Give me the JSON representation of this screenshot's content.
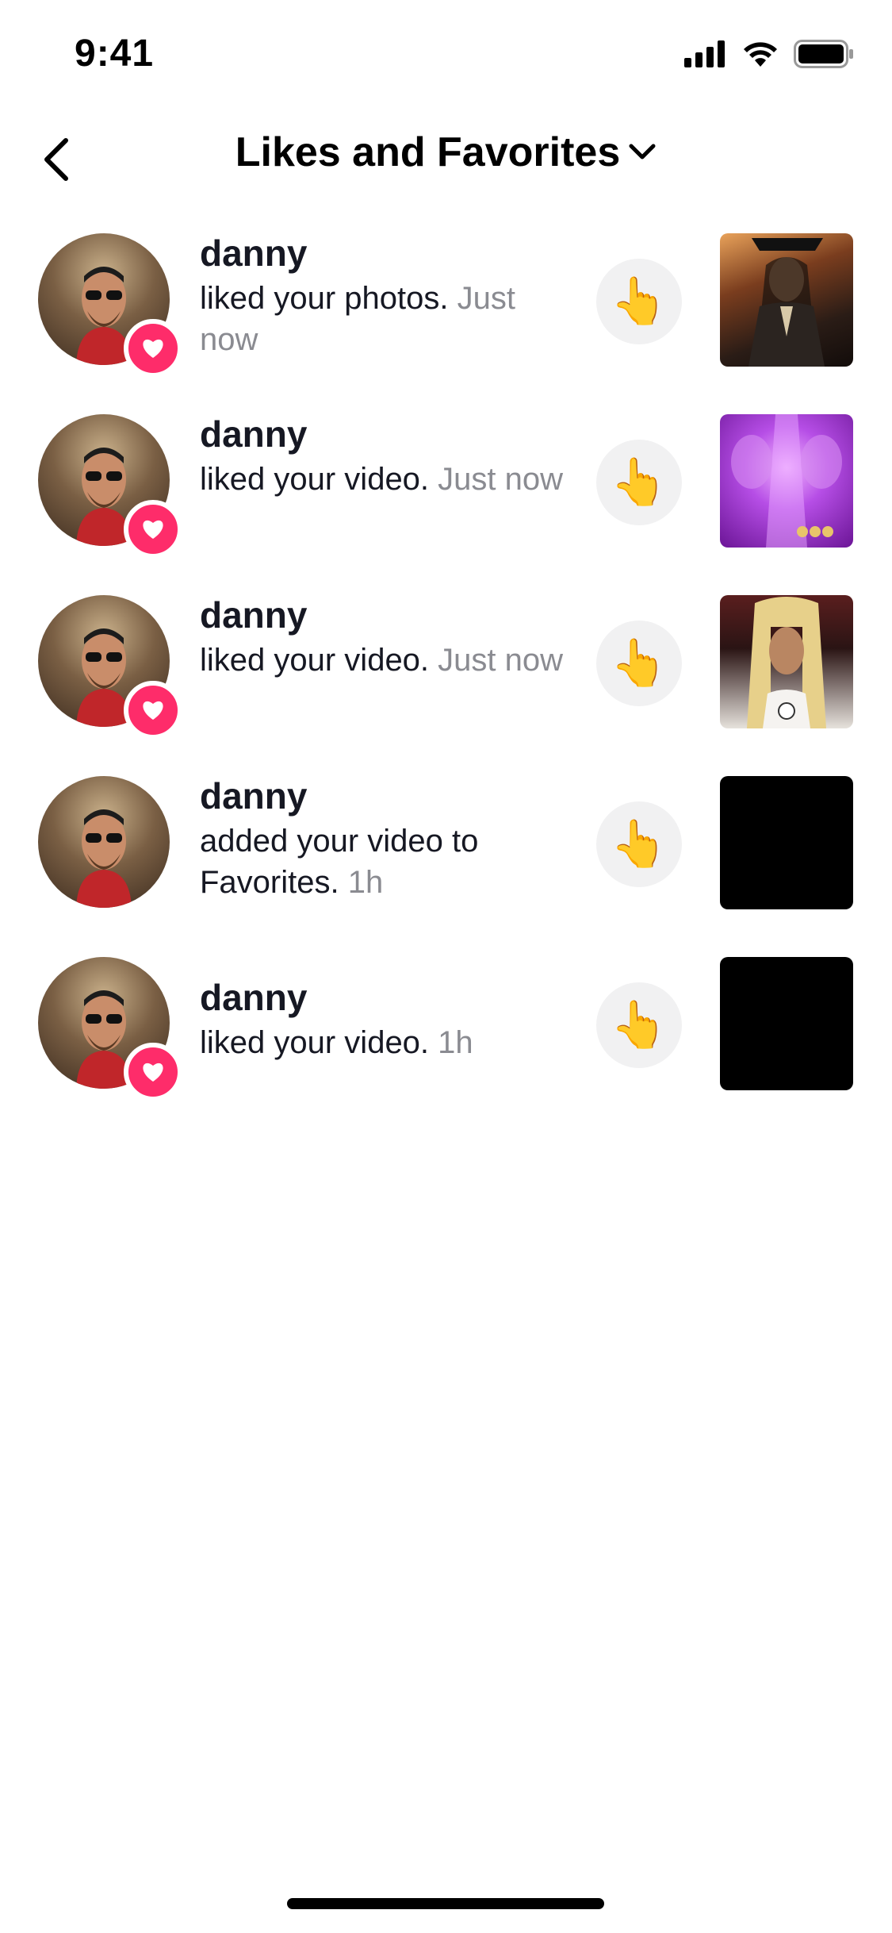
{
  "status_bar": {
    "time": "9:41"
  },
  "header": {
    "title": "Likes and Favorites"
  },
  "colors": {
    "accent_pink": "#fe2c6a",
    "secondary_text": "#8a8b91"
  },
  "notifications": [
    {
      "username": "danny",
      "action": "liked your photos.",
      "time": "Just now",
      "thumbnail": "pirate-portrait"
    },
    {
      "username": "danny",
      "action": "liked your video.",
      "time": "Just now",
      "thumbnail": "purple-effect"
    },
    {
      "username": "danny",
      "action": "liked your video.",
      "time": "Just now",
      "thumbnail": "blonde-portrait"
    },
    {
      "username": "danny",
      "action": "added your video to Favorites.",
      "time": "1h",
      "thumbnail": "black"
    },
    {
      "username": "danny",
      "action": "liked your video.",
      "time": "1h",
      "thumbnail": "black"
    }
  ],
  "icons": {
    "back": "chevron-left-icon",
    "title_dropdown": "chevron-down-icon",
    "badge": "heart-icon",
    "like_back": "pointing-hand-emoji"
  },
  "like_back_glyph": "👆"
}
